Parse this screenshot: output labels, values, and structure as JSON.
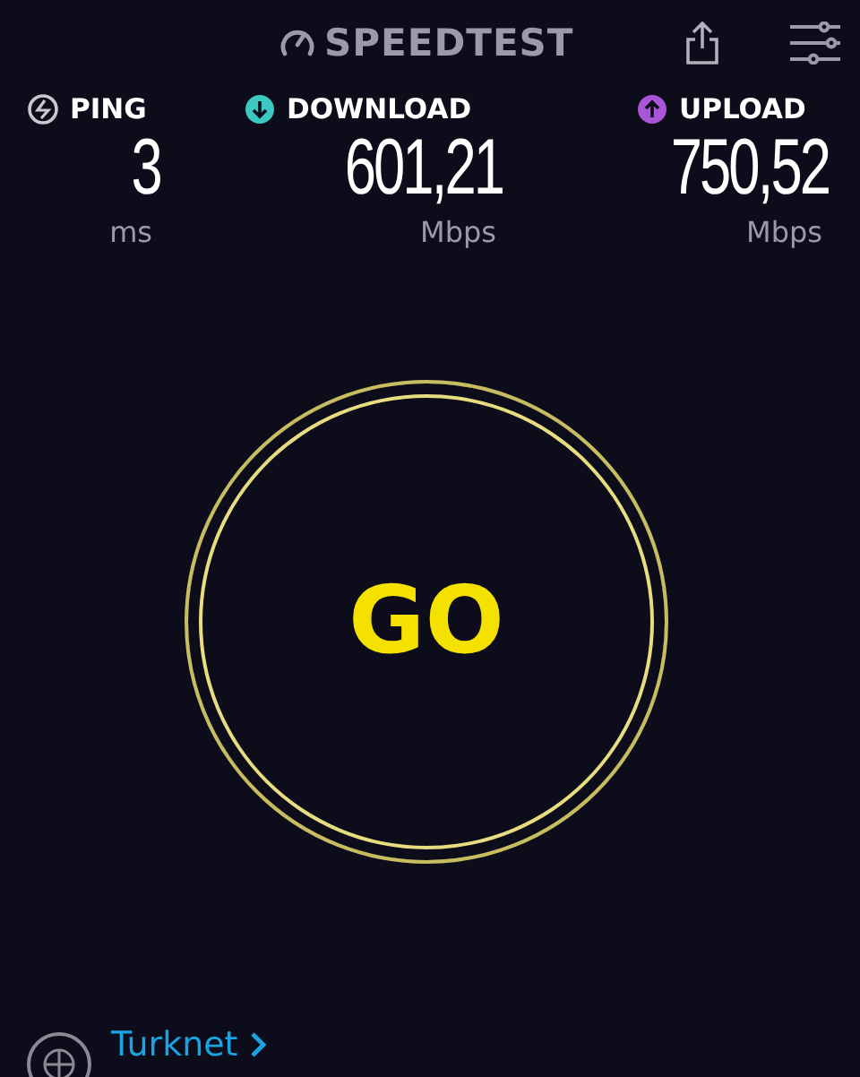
{
  "header": {
    "logo": "SPEEDTEST"
  },
  "metrics": [
    {
      "kind": "ping",
      "label": "PING",
      "value": "3",
      "unit": "ms",
      "color": "#c8c8d0"
    },
    {
      "kind": "download",
      "label": "DOWNLOAD",
      "value": "601,21",
      "unit": "Mbps",
      "color": "#3cc8c0"
    },
    {
      "kind": "upload",
      "label": "UPLOAD",
      "value": "750,52",
      "unit": "Mbps",
      "color": "#a855d8"
    }
  ],
  "go_button": {
    "label": "GO"
  },
  "provider": {
    "name": "Turknet"
  }
}
